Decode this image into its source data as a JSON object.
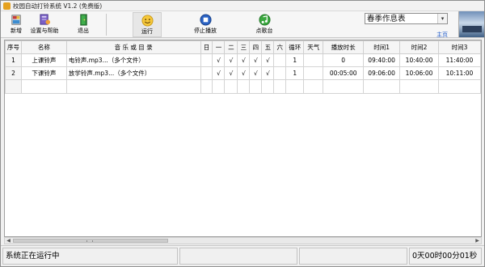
{
  "window": {
    "title": "校园自动打铃系统 V1.2 (免费版)"
  },
  "toolbar": {
    "new_label": "新增",
    "settings_label": "设置与帮助",
    "exit_label": "退出",
    "run_label": "运行",
    "stop_label": "停止播放",
    "control_label": "点歌台",
    "schedule_value": "春季作息表",
    "homepage_label": "主页"
  },
  "columns": [
    "序号",
    "名称",
    "音 乐 或 目 录",
    "日",
    "一",
    "二",
    "三",
    "四",
    "五",
    "六",
    "循环",
    "天气",
    "播放时长",
    "时间1",
    "时间2",
    "时间3"
  ],
  "rows": [
    {
      "no": "1",
      "name": "上课铃声",
      "music": "电铃声.mp3...（多个文件）",
      "sun": "",
      "mon": "√",
      "tue": "√",
      "wed": "√",
      "thu": "√",
      "fri": "√",
      "sat": "",
      "loop": "1",
      "weather": "",
      "duration": "0",
      "t1": "09:40:00",
      "t2": "10:40:00",
      "t3": "11:40:00"
    },
    {
      "no": "2",
      "name": "下课铃声",
      "music": "放学铃声.mp3...（多个文件）",
      "sun": "",
      "mon": "√",
      "tue": "√",
      "wed": "√",
      "thu": "√",
      "fri": "√",
      "sat": "",
      "loop": "1",
      "weather": "",
      "duration": "00:05:00",
      "t1": "09:06:00",
      "t2": "10:06:00",
      "t3": "10:11:00"
    }
  ],
  "status": {
    "message": "系统正在运行中",
    "timer": "0天00时00分01秒"
  },
  "colors": {
    "link": "#1a57c8",
    "grid_border": "#d4d4d4"
  }
}
